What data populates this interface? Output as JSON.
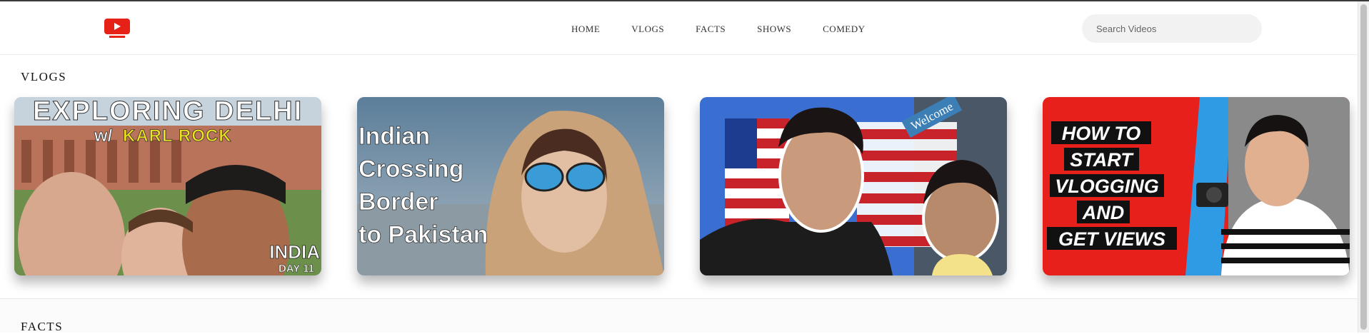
{
  "nav": {
    "items": [
      "HOME",
      "VLOGS",
      "FACTS",
      "SHOWS",
      "COMEDY"
    ]
  },
  "search": {
    "placeholder": "Search Videos"
  },
  "sections": [
    {
      "title": "VLOGS",
      "videos": [
        {
          "thumb_lines": [
            "EXPLORING DELHI",
            "w/",
            "KARL ROCK"
          ],
          "badge": [
            "INDIA",
            "DAY 11"
          ]
        },
        {
          "thumb_lines": [
            "Indian",
            "Crossing",
            "Border",
            "to Pakistan"
          ]
        },
        {
          "thumb_lines": [
            "Welcome"
          ]
        },
        {
          "thumb_lines": [
            "HOW TO",
            "START",
            "VLOGGING",
            "AND",
            "GET VIEWS"
          ]
        }
      ]
    },
    {
      "title": "FACTS"
    }
  ],
  "colors": {
    "brand": "#e62117",
    "text": "#333333"
  },
  "icons": {
    "logo": "youtube-logo-icon"
  }
}
